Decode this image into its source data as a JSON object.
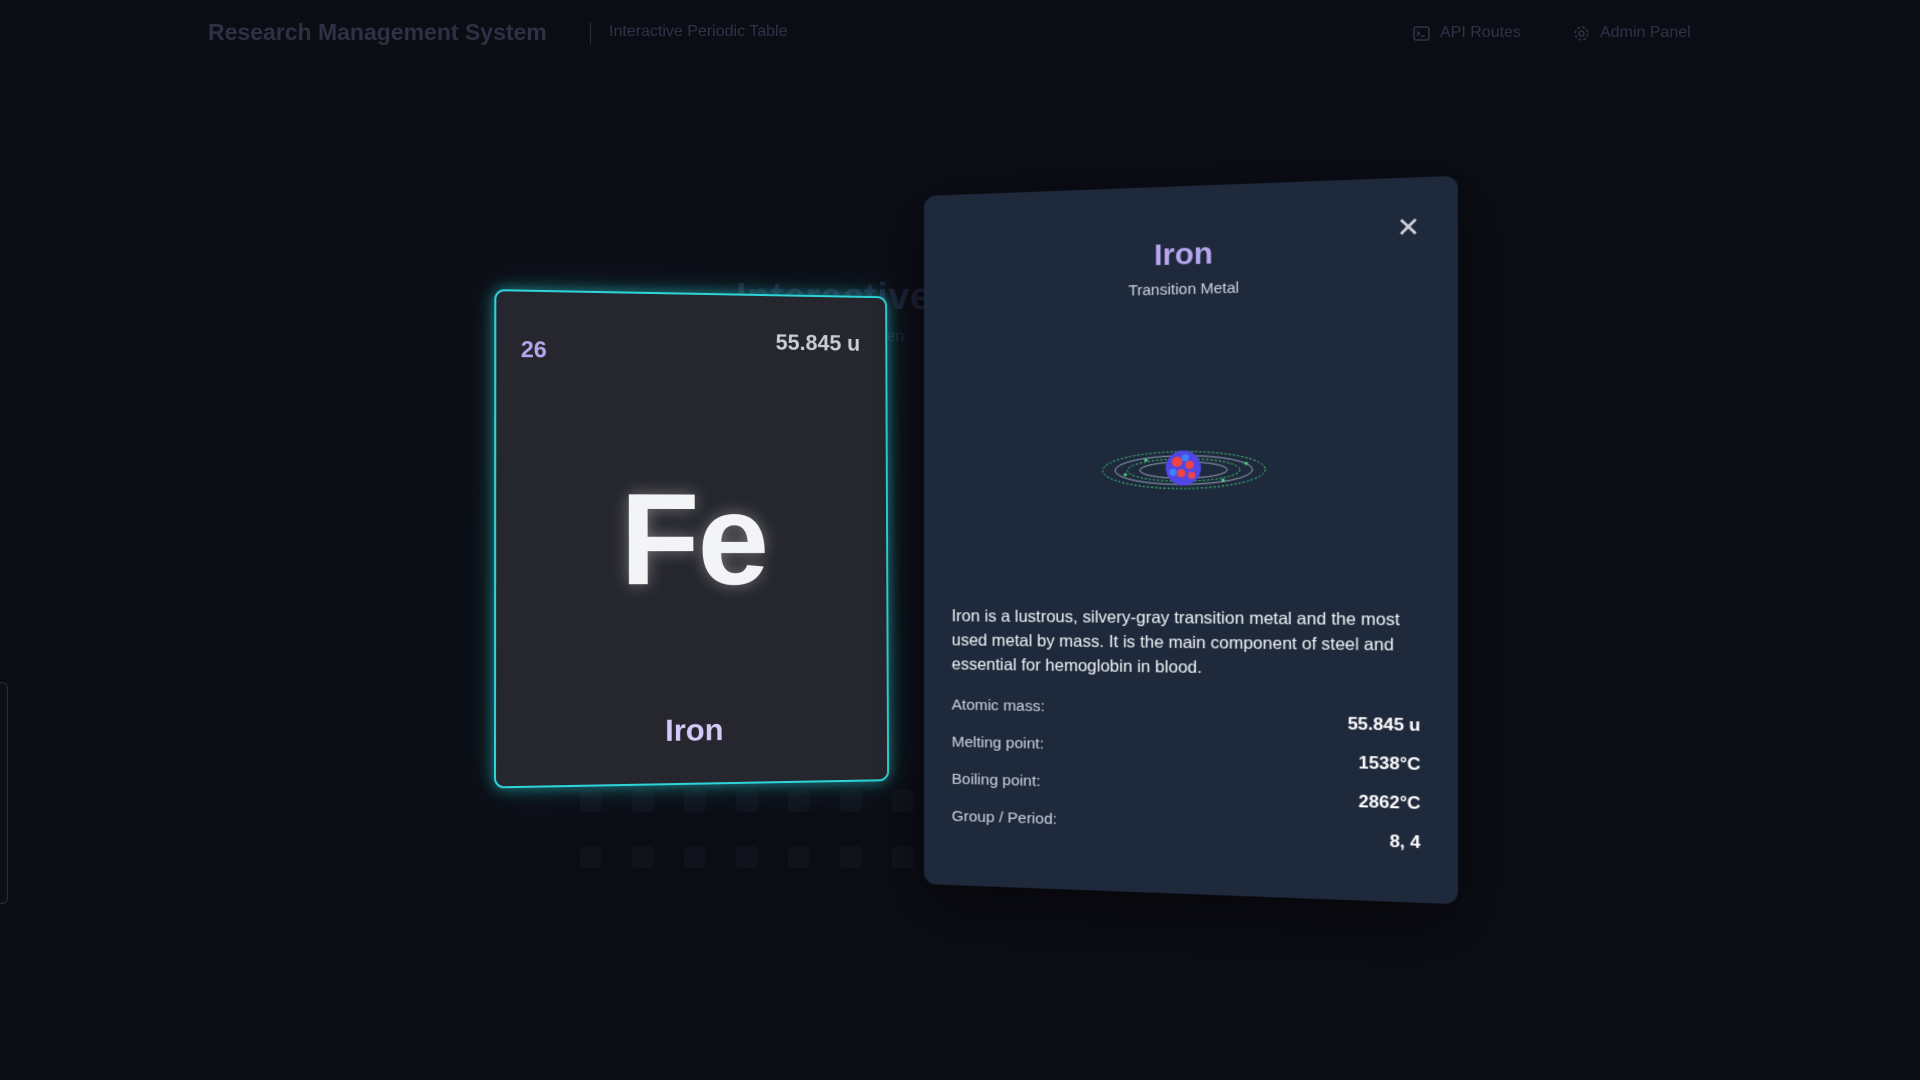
{
  "header": {
    "brand": "Research Management System",
    "subtitle": "Interactive Periodic Table",
    "nav": [
      {
        "label": "API Routes",
        "icon": "terminal-icon"
      },
      {
        "label": "Admin Panel",
        "icon": "gear-icon"
      }
    ]
  },
  "background": {
    "title": "Interactive",
    "subtitle": "Elemen"
  },
  "element": {
    "number": "26",
    "mass": "55.845 u",
    "symbol": "Fe",
    "name": "Iron",
    "border_color": "#2dd4d8"
  },
  "detail": {
    "title": "Iron",
    "category": "Transition Metal",
    "close_label": "✕",
    "description": "Iron is a lustrous, silvery-gray transition metal and the most used metal by mass. It is the main component of steel and essential for hemoglobin in blood.",
    "properties": [
      {
        "label": "Atomic mass:",
        "value": "55.845 u"
      },
      {
        "label": "Melting point:",
        "value": "1538°C"
      },
      {
        "label": "Boiling point:",
        "value": "2862°C"
      },
      {
        "label": "Group / Period:",
        "value": "8, 4"
      }
    ],
    "accent_color": "#b7a6ef",
    "panel_color": "#1e293b"
  }
}
